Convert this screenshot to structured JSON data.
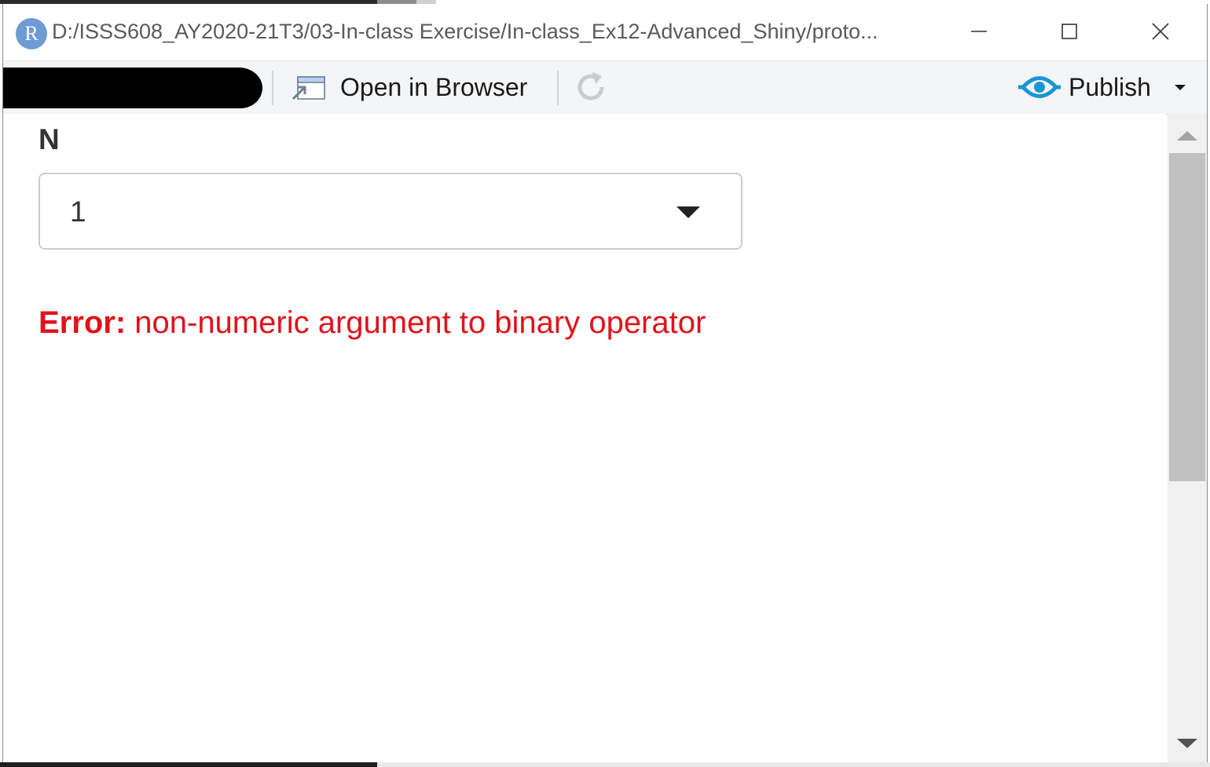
{
  "window": {
    "title": "D:/ISSS608_AY2020-21T3/03-In-class Exercise/In-class_Ex12-Advanced_Shiny/proto...",
    "app_icon_letter": "R",
    "minimize_icon": "minimize-icon",
    "maximize_icon": "maximize-icon",
    "close_icon": "close-icon"
  },
  "toolbar": {
    "open_in_browser_label": "Open in Browser",
    "publish_label": "Publish",
    "accent_color": "#1a95d6"
  },
  "content": {
    "field_label": "N",
    "select_value": "1",
    "error_prefix": "Error:",
    "error_message": " non-numeric argument to binary operator",
    "error_color": "#e0131b"
  }
}
